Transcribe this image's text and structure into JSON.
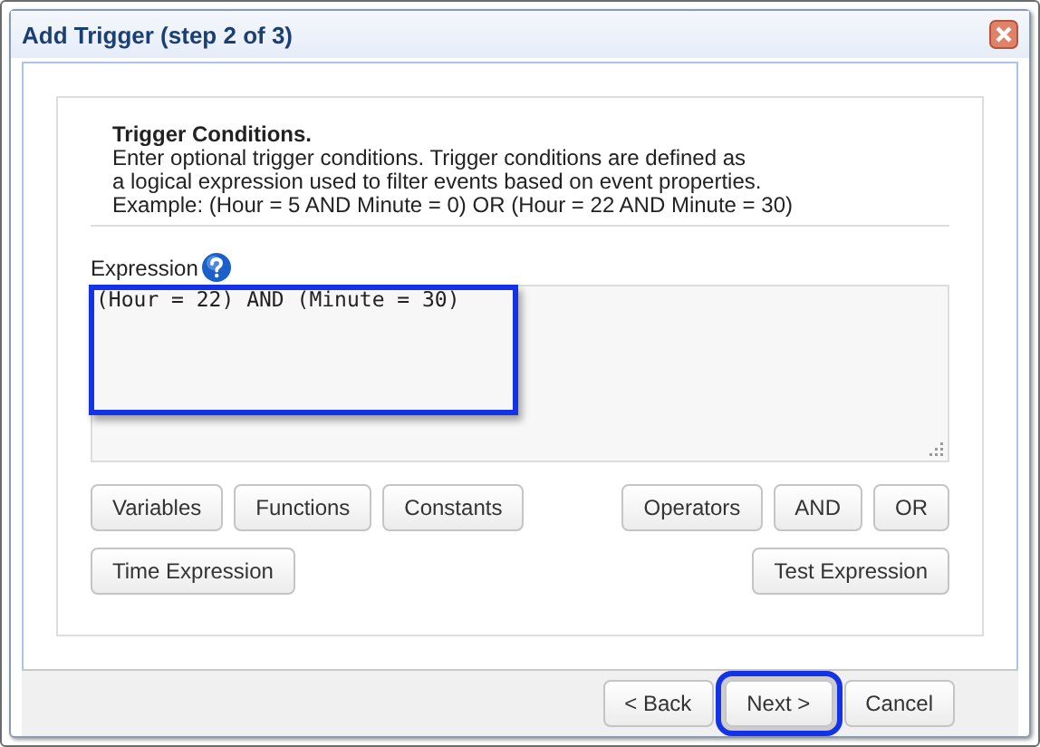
{
  "window": {
    "title": "Add Trigger (step 2 of 3)"
  },
  "intro": {
    "heading": "Trigger Conditions.",
    "lines": [
      "Enter optional trigger conditions. Trigger conditions are defined as",
      "a logical expression used to filter events based on event properties.",
      "Example: (Hour = 5 AND Minute = 0) OR (Hour = 22 AND Minute = 30)"
    ]
  },
  "expression": {
    "label": "Expression",
    "value": "(Hour = 22) AND (Minute = 30)",
    "highlighted": true
  },
  "button_rows": [
    {
      "left": [
        "Variables",
        "Functions",
        "Constants"
      ],
      "right": [
        "Operators",
        "AND",
        "OR"
      ]
    },
    {
      "left": [
        "Time Expression"
      ],
      "right": [
        "Test Expression"
      ]
    }
  ],
  "footer_buttons": [
    {
      "label": "< Back",
      "highlighted": false
    },
    {
      "label": "Next >",
      "highlighted": true
    },
    {
      "label": "Cancel",
      "highlighted": false
    }
  ]
}
